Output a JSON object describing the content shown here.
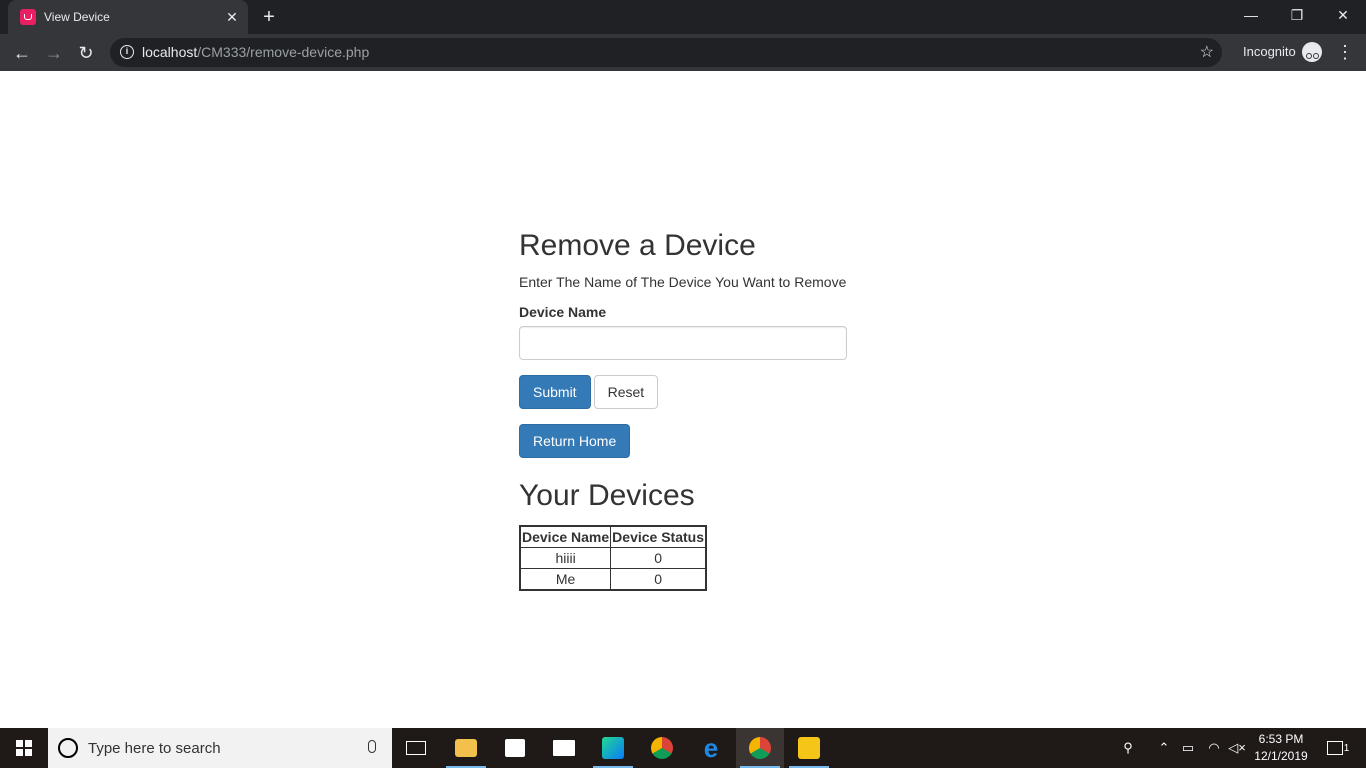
{
  "browser": {
    "tab_title": "View Device",
    "tab_close": "✕",
    "new_tab": "+",
    "url_host": "localhost",
    "url_path": "/CM333/remove-device.php",
    "incognito_label": "Incognito",
    "window_controls": {
      "minimize": "—",
      "restore": "❐",
      "close": "✕"
    }
  },
  "page": {
    "heading": "Remove a Device",
    "subtitle": "Enter The Name of The Device You Want to Remove",
    "field_label": "Device Name",
    "field_value": "",
    "submit_label": "Submit",
    "reset_label": "Reset",
    "home_label": "Return Home",
    "devices_heading": "Your Devices",
    "table": {
      "headers": [
        "Device Name",
        "Device Status"
      ],
      "rows": [
        [
          "hiiii",
          "0"
        ],
        [
          "Me",
          "0"
        ]
      ]
    },
    "primary_color": "#337ab7"
  },
  "taskbar": {
    "search_placeholder": "Type here to search",
    "time": "6:53 PM",
    "date": "12/1/2019",
    "notification_count": "1",
    "pinned_apps": [
      "task-view-icon",
      "file-explorer-icon",
      "store-icon",
      "mail-icon",
      "webstorm-icon",
      "chrome-icon",
      "edge-icon",
      "chrome-active-icon",
      "xampp-icon"
    ]
  }
}
